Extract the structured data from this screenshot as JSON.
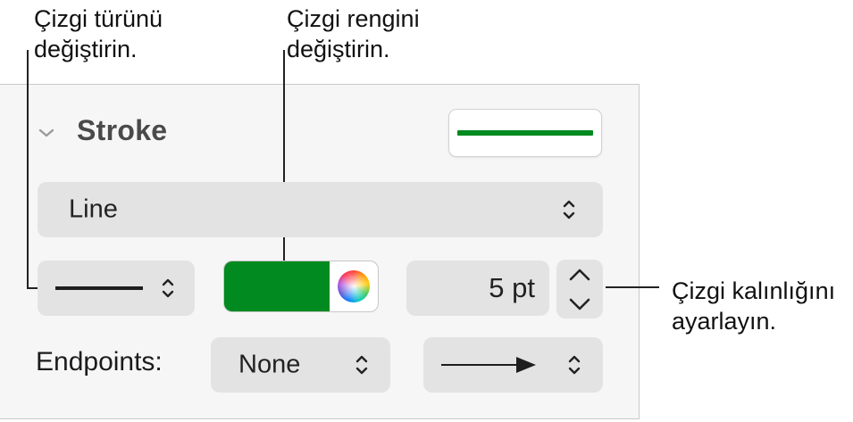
{
  "callouts": {
    "line_type": "Çizgi türünü\ndeğiştirin.",
    "line_color": "Çizgi rengini\ndeğiştirin.",
    "line_width": "Çizgi kalınlığını\nayarlayın."
  },
  "stroke": {
    "section_title": "Stroke",
    "collapse_icon": "chevron-down-icon",
    "preview_color": "#008a1f",
    "style_popup": {
      "value": "Line",
      "icon": "updown-chevron-icon"
    },
    "line_type_popup": {
      "icon": "updown-chevron-icon"
    },
    "color_well": {
      "color": "#008a1f",
      "wheel_icon": "color-wheel-icon"
    },
    "width": {
      "value": "5 pt",
      "stepper_up_icon": "chevron-up-icon",
      "stepper_down_icon": "chevron-down-icon"
    },
    "endpoints": {
      "label": "Endpoints:",
      "start_value": "None",
      "end_icon": "arrow-right-icon"
    }
  }
}
